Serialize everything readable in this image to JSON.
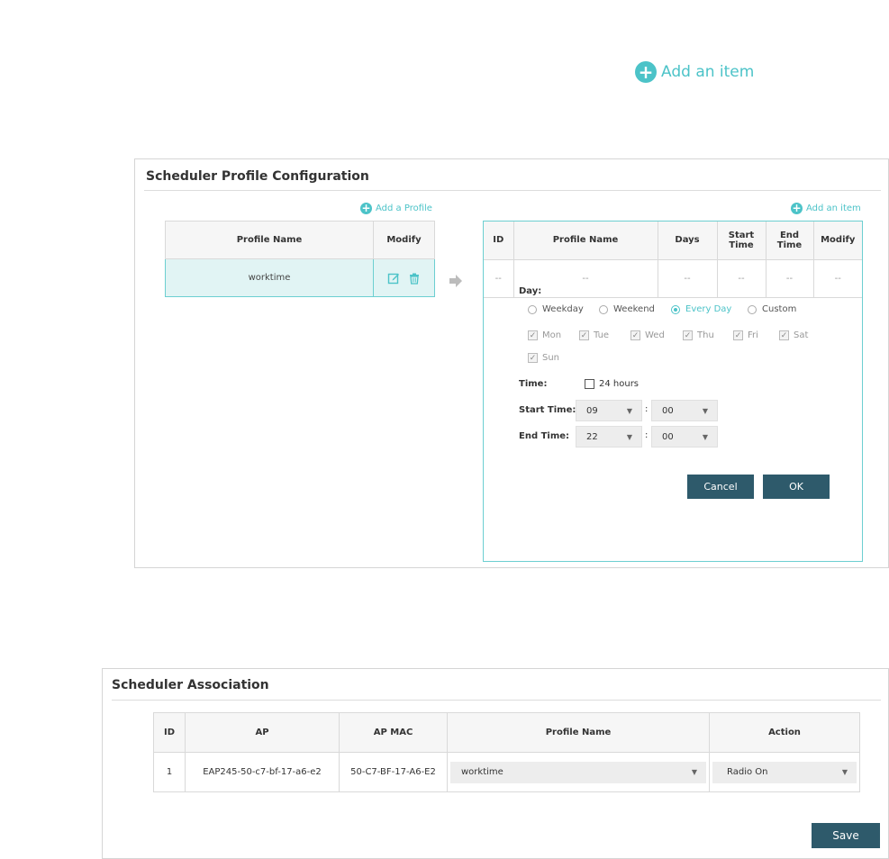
{
  "top_action": {
    "label": "Add an item"
  },
  "profile_config": {
    "title": "Scheduler Profile Configuration",
    "add_profile_label": "Add a Profile",
    "add_item_label": "Add an item",
    "profile_table": {
      "headers": [
        "Profile Name",
        "Modify"
      ],
      "rows": [
        {
          "name": "worktime"
        }
      ]
    },
    "items_table": {
      "headers": [
        "ID",
        "Profile Name",
        "Days",
        "Start Time",
        "End Time",
        "Modify"
      ],
      "rows": [
        [
          "--",
          "--",
          "--",
          "--",
          "--",
          "--"
        ]
      ]
    },
    "form": {
      "day_label": "Day:",
      "day_options": [
        "Weekday",
        "Weekend",
        "Every Day",
        "Custom"
      ],
      "day_selected": "Every Day",
      "weekdays": [
        "Mon",
        "Tue",
        "Wed",
        "Thu",
        "Fri",
        "Sat",
        "Sun"
      ],
      "time_label": "Time:",
      "hours24_label": "24 hours",
      "start_label": "Start Time:",
      "start_hour": "09",
      "start_min": "00",
      "end_label": "End Time:",
      "end_hour": "22",
      "end_min": "00",
      "colon": ":",
      "cancel_label": "Cancel",
      "ok_label": "OK"
    }
  },
  "association": {
    "title": "Scheduler Association",
    "headers": [
      "ID",
      "AP",
      "AP MAC",
      "Profile Name",
      "Action"
    ],
    "rows": [
      {
        "id": "1",
        "ap": "EAP245-50-c7-bf-17-a6-e2",
        "mac": "50-C7-BF-17-A6-E2",
        "profile": "worktime",
        "action": "Radio On"
      }
    ],
    "save_label": "Save"
  },
  "colors": {
    "accent": "#4cc3c8",
    "button": "#2e5a6b",
    "selected_row": "#e1f4f4"
  },
  "icons": [
    "plus-circle-icon",
    "edit-icon",
    "trash-icon",
    "arrow-right-icon",
    "caret-down-icon",
    "check-icon"
  ]
}
